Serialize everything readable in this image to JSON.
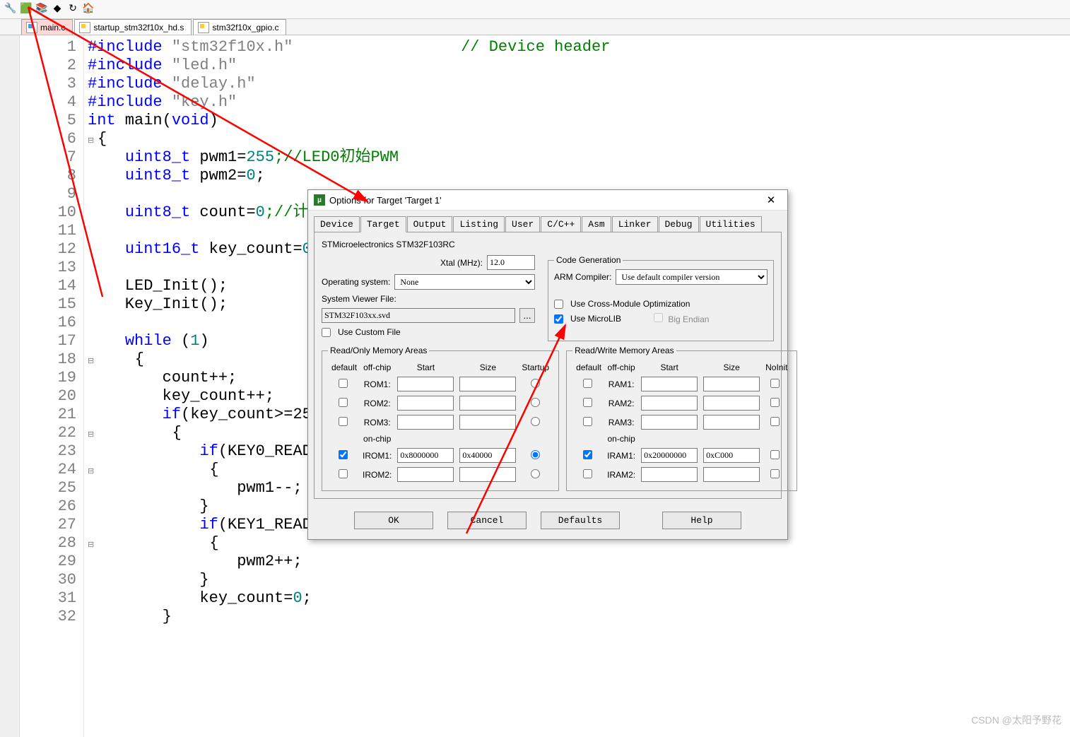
{
  "tabs": [
    {
      "label": "main.c",
      "active": true,
      "icon": "c"
    },
    {
      "label": "startup_stm32f10x_hd.s",
      "active": false,
      "icon": "s"
    },
    {
      "label": "stm32f10x_gpio.c",
      "active": false,
      "icon": "s"
    }
  ],
  "lines": [
    "1",
    "2",
    "3",
    "4",
    "5",
    "6",
    "7",
    "8",
    "9",
    "10",
    "11",
    "12",
    "13",
    "14",
    "15",
    "16",
    "17",
    "18",
    "19",
    "20",
    "21",
    "22",
    "23",
    "24",
    "25",
    "26",
    "27",
    "28",
    "29",
    "30",
    "31",
    "32"
  ],
  "code": [
    {
      "t": "#include",
      "s": "\"stm32f10x.h\"",
      "c": "// Device header",
      "pad": "                  "
    },
    {
      "t": "#include",
      "s": "\"led.h\""
    },
    {
      "t": "#include",
      "s": "\"delay.h\""
    },
    {
      "t": "#include",
      "s": "\"key.h\""
    },
    {
      "t": "int",
      "id": "main",
      "p": "void"
    },
    {
      "brace": "{",
      "fold": true
    },
    {
      "indent": 1,
      "t": "uint8_t",
      "id": "pwm1",
      "eq": "=",
      "n": "255",
      "c": ";//LED0初始PWM"
    },
    {
      "indent": 1,
      "t": "uint8_t",
      "id": "pwm2",
      "eq": "=",
      "n": "0",
      "semi": ";"
    },
    {
      "blank": true
    },
    {
      "indent": 1,
      "t": "uint8_t",
      "id": "count",
      "eq": "=",
      "n": "0",
      "c": ";//计"
    },
    {
      "blank": true
    },
    {
      "indent": 1,
      "t": "uint16_t",
      "id": "key_count",
      "eq": "=",
      "n": "0"
    },
    {
      "blank": true
    },
    {
      "indent": 1,
      "call": "LED_Init();"
    },
    {
      "indent": 1,
      "call": "Key_Init();"
    },
    {
      "blank": true
    },
    {
      "indent": 1,
      "t": "while",
      "p": "1"
    },
    {
      "indent": 1,
      "brace": "{",
      "fold": true
    },
    {
      "indent": 2,
      "stmt": "count++;"
    },
    {
      "indent": 2,
      "stmt": "key_count++;"
    },
    {
      "indent": 2,
      "t": "if",
      "expr": "(key_count>=25"
    },
    {
      "indent": 2,
      "brace": "{",
      "fold": true
    },
    {
      "indent": 3,
      "t": "if",
      "expr": "(KEY0_READ"
    },
    {
      "indent": 3,
      "brace": "{",
      "fold": true
    },
    {
      "indent": 4,
      "stmt": "pwm1--;"
    },
    {
      "indent": 3,
      "brace": "}"
    },
    {
      "indent": 3,
      "t": "if",
      "expr": "(KEY1_READ"
    },
    {
      "indent": 3,
      "brace": "{",
      "fold": true
    },
    {
      "indent": 4,
      "stmt": "pwm2++;"
    },
    {
      "indent": 3,
      "brace": "}"
    },
    {
      "indent": 3,
      "stmt": "key_count=",
      "n": "0",
      "semi": ";"
    },
    {
      "indent": 2,
      "brace": "}"
    }
  ],
  "dialog": {
    "title": "Options for Target 'Target 1'",
    "tabs": [
      "Device",
      "Target",
      "Output",
      "Listing",
      "User",
      "C/C++",
      "Asm",
      "Linker",
      "Debug",
      "Utilities"
    ],
    "active_tab": "Target",
    "chip": "STMicroelectronics STM32F103RC",
    "xtal_label": "Xtal (MHz):",
    "xtal": "12.0",
    "os_label": "Operating system:",
    "os": "None",
    "svf_label": "System Viewer File:",
    "svf": "STM32F103xx.svd",
    "custom_label": "Use Custom File",
    "codegen_label": "Code Generation",
    "arm_label": "ARM Compiler:",
    "arm": "Use default compiler version",
    "crossmod": "Use Cross-Module Optimization",
    "microlib": "Use MicroLIB",
    "bigendian": "Big Endian",
    "ro_label": "Read/Only Memory Areas",
    "rw_label": "Read/Write Memory Areas",
    "hdr": {
      "default": "default",
      "offchip": "off-chip",
      "onchip": "on-chip",
      "start": "Start",
      "size": "Size",
      "startup": "Startup",
      "noinit": "NoInit"
    },
    "rom": [
      "ROM1:",
      "ROM2:",
      "ROM3:",
      "IROM1:",
      "IROM2:"
    ],
    "ram": [
      "RAM1:",
      "RAM2:",
      "RAM3:",
      "IRAM1:",
      "IRAM2:"
    ],
    "irom1_start": "0x8000000",
    "irom1_size": "0x40000",
    "iram1_start": "0x20000000",
    "iram1_size": "0xC000",
    "buttons": {
      "ok": "OK",
      "cancel": "Cancel",
      "defaults": "Defaults",
      "help": "Help"
    }
  },
  "watermark": "CSDN @太阳予野花"
}
